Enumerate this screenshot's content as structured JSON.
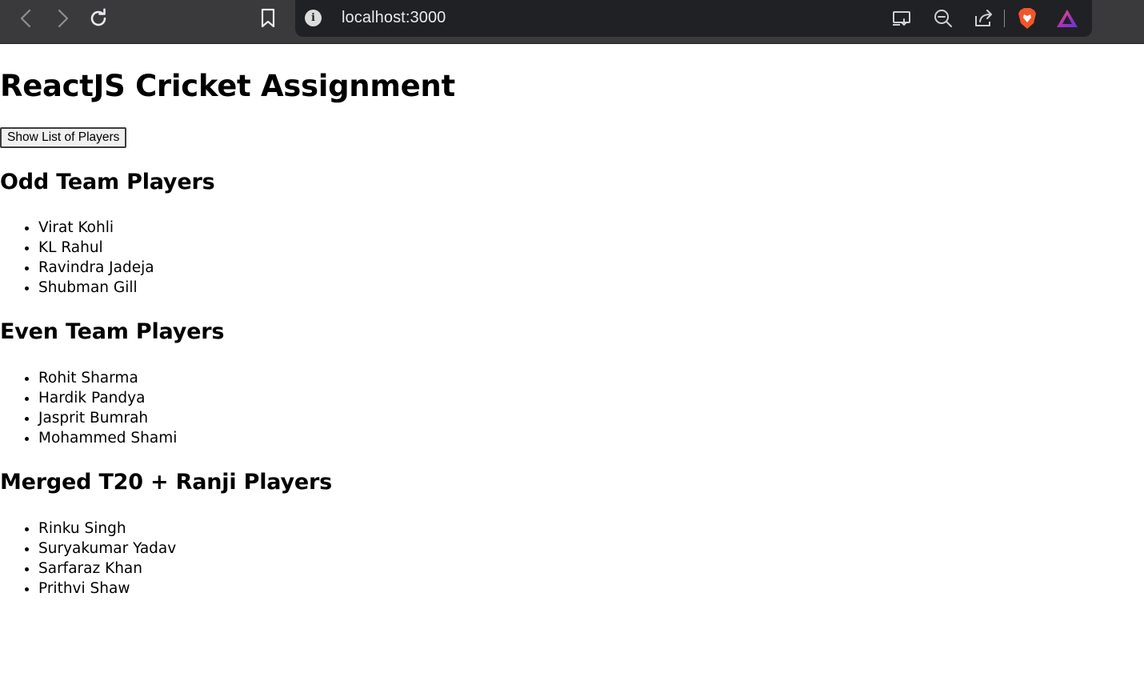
{
  "browser": {
    "url": "localhost:3000"
  },
  "page": {
    "title": "ReactJS Cricket Assignment",
    "show_button_label": "Show List of Players",
    "sections": [
      {
        "heading": "Odd Team Players",
        "players": [
          "Virat Kohli",
          "KL Rahul",
          "Ravindra Jadeja",
          "Shubman Gill"
        ]
      },
      {
        "heading": "Even Team Players",
        "players": [
          "Rohit Sharma",
          "Hardik Pandya",
          "Jasprit Bumrah",
          "Mohammed Shami"
        ]
      },
      {
        "heading": "Merged T20 + Ranji Players",
        "players": [
          "Rinku Singh",
          "Suryakumar Yadav",
          "Sarfaraz Khan",
          "Prithvi Shaw"
        ]
      }
    ]
  },
  "icons": {
    "back": "back-arrow-icon",
    "forward": "forward-arrow-icon",
    "reload": "reload-icon",
    "bookmark": "bookmark-icon",
    "info": "info-icon",
    "cast": "cast-install-icon",
    "zoom": "zoom-out-icon",
    "share": "share-icon",
    "brave": "brave-shields-icon",
    "rewards": "brave-rewards-icon"
  },
  "colors": {
    "chrome_bg": "#3a3a3d",
    "address_bg": "#202124",
    "brave_orange": "#f1562b"
  }
}
